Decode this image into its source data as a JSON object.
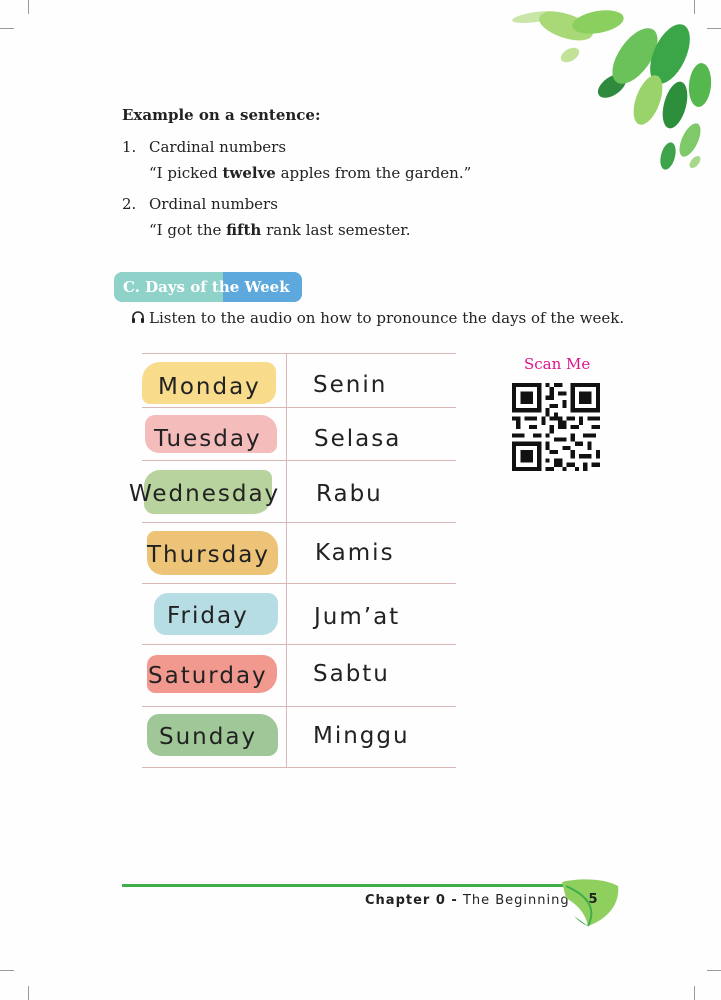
{
  "example": {
    "heading": "Example on a sentence:",
    "items": [
      {
        "num": "1.",
        "label": "Cardinal numbers",
        "sentence_pre": "“I picked ",
        "sentence_bold": "twelve",
        "sentence_post": " apples from the garden.”"
      },
      {
        "num": "2.",
        "label": "Ordinal numbers",
        "sentence_pre": "“I got the ",
        "sentence_bold": "fifth",
        "sentence_post": " rank last semester."
      }
    ]
  },
  "section": {
    "title": "C.  Days of the Week"
  },
  "listen": {
    "icon": "headphones-icon",
    "text": "Listen to the audio on how to pronounce the days of the week."
  },
  "days": [
    {
      "english": "Monday",
      "indonesian": "Senin",
      "color": "#f8dc8c"
    },
    {
      "english": "Tuesday",
      "indonesian": "Selasa",
      "color": "#f5bcbc"
    },
    {
      "english": "Wednesday",
      "indonesian": "Rabu",
      "color": "#b8d39e"
    },
    {
      "english": "Thursday",
      "indonesian": "Kamis",
      "color": "#edc477"
    },
    {
      "english": "Friday",
      "indonesian": "Jum’at",
      "color": "#b6dde3"
    },
    {
      "english": "Saturday",
      "indonesian": "Sabtu",
      "color": "#f1998e"
    },
    {
      "english": "Sunday",
      "indonesian": "Minggu",
      "color": "#9fc797"
    }
  ],
  "qr": {
    "label": "Scan Me"
  },
  "footer": {
    "chapter": "Chapter 0 -",
    "title": " The Beginning",
    "page": "5"
  },
  "colors": {
    "accent_green": "#3fae4a",
    "scan_pink": "#e0148a",
    "section_teal": "#8fd2c9",
    "section_blue": "#5da8dd"
  }
}
